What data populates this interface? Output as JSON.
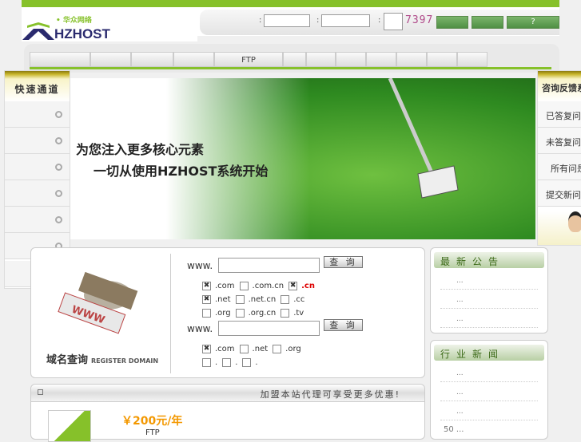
{
  "header": {
    "logo_text": "HZHOST",
    "logo_cn": "• 华众网络",
    "colon": ":",
    "captcha": "7397",
    "buttons": [
      "",
      "",
      "?"
    ]
  },
  "nav": {
    "items": [
      "",
      "",
      "",
      "",
      "FTP",
      "",
      "",
      "",
      "",
      "",
      "",
      ""
    ]
  },
  "left_panel": {
    "title": "快速通道",
    "items": 7
  },
  "banner": {
    "line1": "为您注入更多核心元素",
    "line2": "一切从使用HZHOST系统开始"
  },
  "right_panel": {
    "title": "咨询反馈系",
    "items": [
      "已答复问",
      "未答复问",
      "所有问是",
      "提交新问"
    ]
  },
  "domain": {
    "title": "域名查询",
    "subtitle": "REGISTER DOMAIN",
    "www": "www.",
    "query": "查 询",
    "rows1": [
      [
        {
          "l": ".com",
          "c": true
        },
        {
          "l": ".com.cn",
          "c": false
        },
        {
          "l": ".cn",
          "c": true,
          "red": true
        }
      ],
      [
        {
          "l": ".net",
          "c": true
        },
        {
          "l": ".net.cn",
          "c": false
        },
        {
          "l": ".cc",
          "c": false
        }
      ],
      [
        {
          "l": ".org",
          "c": false
        },
        {
          "l": ".org.cn",
          "c": false
        },
        {
          "l": ".tv",
          "c": false
        }
      ]
    ],
    "rows2": [
      [
        {
          "l": ".com",
          "c": true
        },
        {
          "l": ".net",
          "c": false
        },
        {
          "l": ".org",
          "c": false
        }
      ],
      [
        {
          "l": ".",
          "c": false
        },
        {
          "l": ".",
          "c": false
        },
        {
          "l": ".",
          "c": false
        }
      ]
    ],
    "check_mark": "✖"
  },
  "notices": {
    "title": "最新公告",
    "items": [
      "...",
      "...",
      "..."
    ]
  },
  "news": {
    "title": "行业新闻",
    "items": [
      "...",
      "...",
      "...",
      "50 ..."
    ]
  },
  "promo": {
    "header": "加盟本站代理可享受更多优惠!",
    "price": "￥200元/年",
    "product": "FTP"
  }
}
